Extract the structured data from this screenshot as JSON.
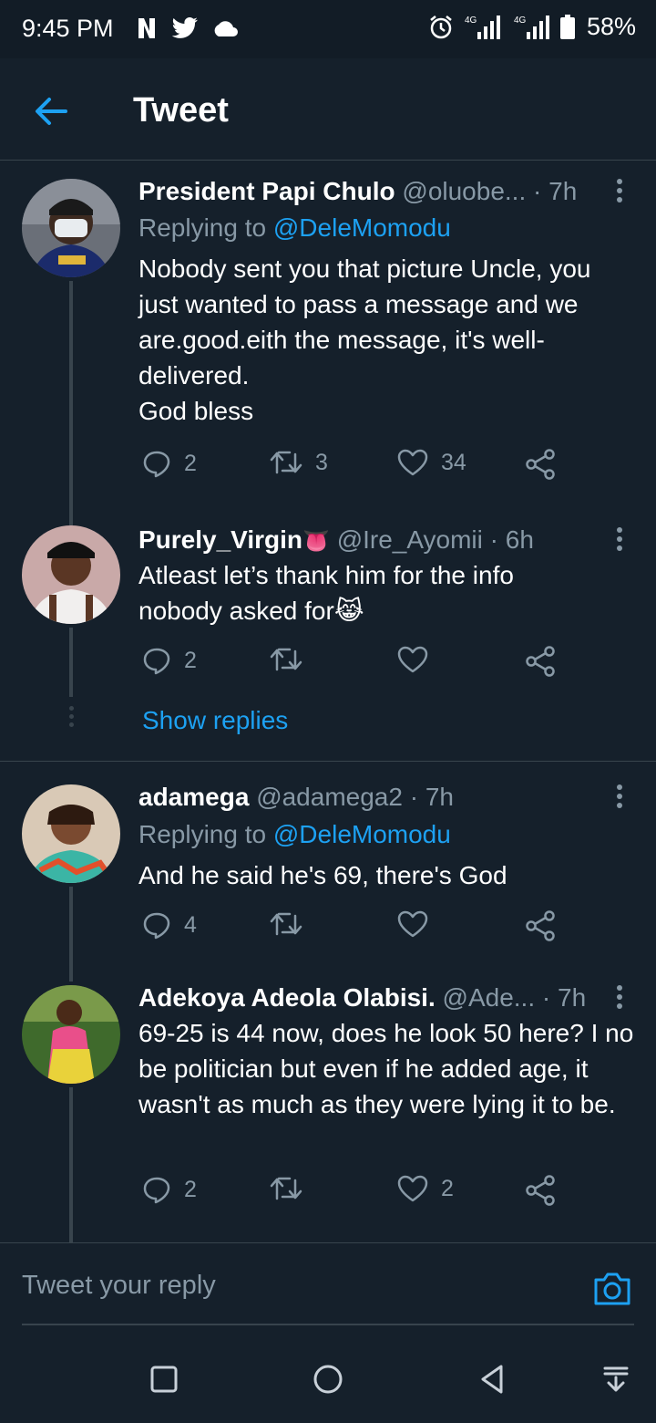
{
  "status_bar": {
    "time": "9:45 PM",
    "battery": "58%",
    "net1": "4G",
    "net2": "4G"
  },
  "app_bar": {
    "title": "Tweet"
  },
  "tweets": [
    {
      "name": "President Papi Chulo",
      "handle": "@oluobe...",
      "time": "· 7h",
      "replying_prefix": "Replying to ",
      "replying_to": "@DeleMomodu",
      "text": "Nobody sent you that picture Uncle, you just wanted to pass a message and we are.good.eith the message, it's well-delivered.\nGod bless",
      "replies": "2",
      "retweets": "3",
      "likes": "34"
    },
    {
      "name": "Purely_Virgin",
      "name_emoji": "👅",
      "handle": "@Ire_Ayomii",
      "time": "· 6h",
      "text": "Atleast let’s thank him for the info nobody asked for😹",
      "replies": "2",
      "retweets": "",
      "likes": "",
      "show_replies": "Show replies"
    },
    {
      "name": "adamega",
      "handle": "@adamega2",
      "time": "· 7h",
      "replying_prefix": "Replying to ",
      "replying_to": "@DeleMomodu",
      "text": "And he said he's 69, there's God",
      "replies": "4",
      "retweets": "",
      "likes": ""
    },
    {
      "name": "Adekoya Adeola Olabisi.",
      "handle": "@Ade...",
      "time": "· 7h",
      "text": "69-25 is 44 now, does he look 50 here? I no be politician but even if he added age, it wasn't as much as they were lying it to be.",
      "replies": "2",
      "retweets": "",
      "likes": "2"
    }
  ],
  "reply_bar": {
    "placeholder": "Tweet your reply"
  },
  "colors": {
    "background": "#15202b",
    "accent": "#1da1f2",
    "muted": "#8899a6",
    "border": "#38444d"
  },
  "icons": [
    "back-arrow-icon",
    "more-vertical-icon",
    "reply-icon",
    "retweet-icon",
    "like-icon",
    "share-icon",
    "camera-icon",
    "alarm-icon",
    "signal-icon",
    "battery-icon",
    "cloud-icon",
    "twitter-bird-icon",
    "netflix-n-icon"
  ]
}
